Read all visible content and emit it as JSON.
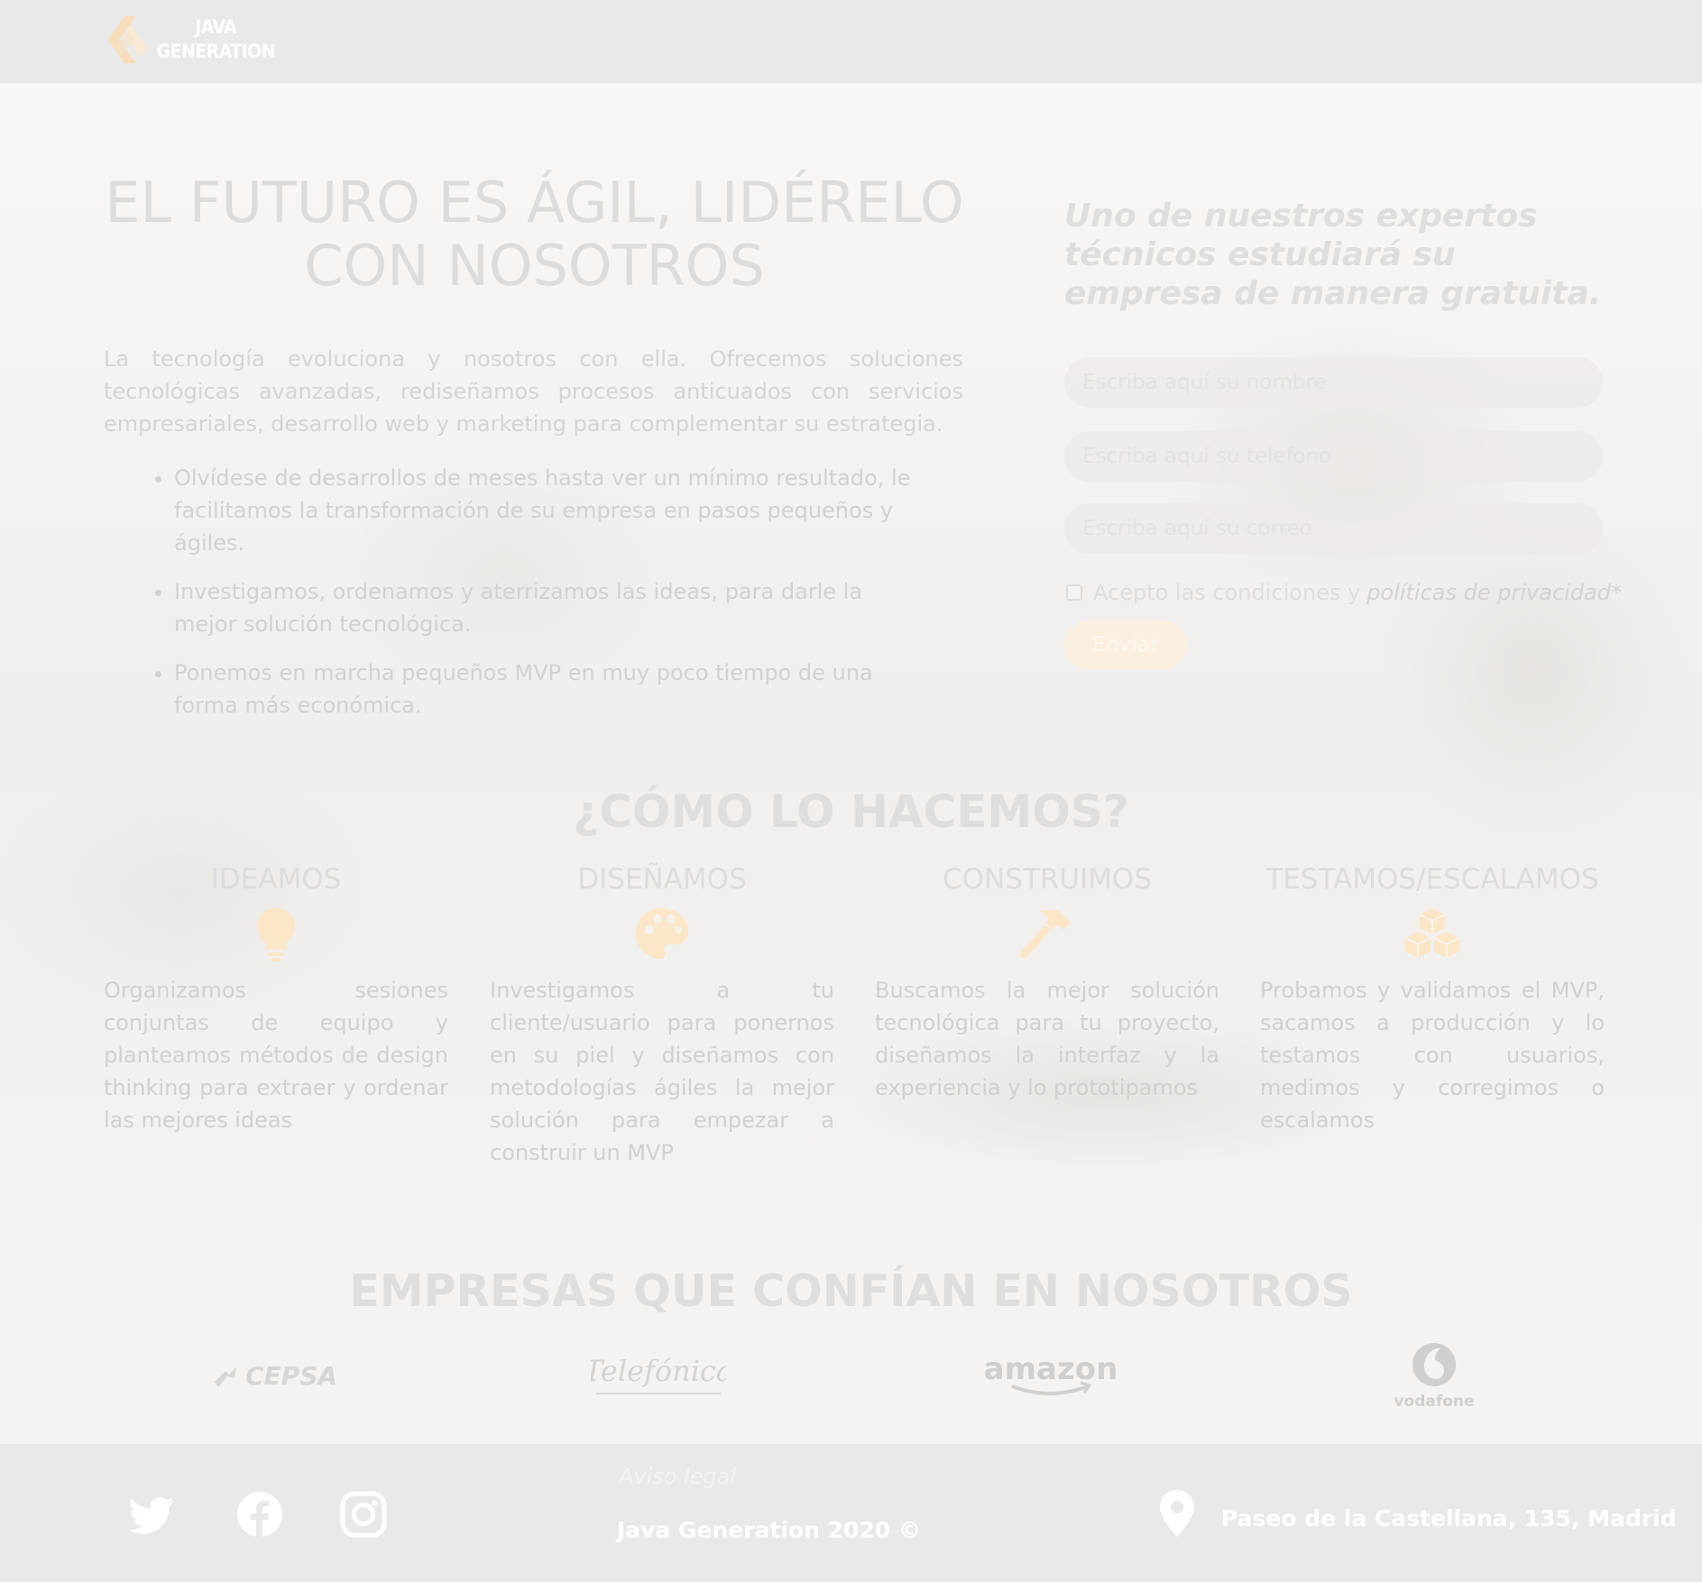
{
  "brand": {
    "logo_line1": "JAVA",
    "logo_line2": "GENERATION",
    "accent_color": "#fbe9cf"
  },
  "hero": {
    "title": "EL FUTURO ES ÁGIL, LIDÉRELO CON NOSOTROS",
    "intro": "La tecnología evoluciona y nosotros con ella. Ofrecemos soluciones tecnológicas avanzadas, rediseñamos procesos anticuados con servicios empresariales, desarrollo web y marketing para complementar su estrategia.",
    "bullets": [
      "Olvídese de desarrollos de meses hasta ver un mínimo resultado, le facilitamos la transformación de su empresa en pasos pequeños y ágiles.",
      "Investigamos, ordenamos y aterrizamos las ideas, para darle la mejor solución tecnológica.",
      "Ponemos en marcha pequeños MVP en muy poco tiempo de una forma más económica."
    ]
  },
  "form": {
    "heading": "Uno de nuestros expertos técnicos estudiará su empresa de manera gratuita.",
    "name_placeholder": "Escriba aquí su nombre",
    "phone_placeholder": "Escriba aquí su telefono",
    "email_placeholder": "Escriba aquí su correo",
    "consent_text": "Acepto las condiciones y",
    "consent_link": "políticas de privacidad*",
    "submit_label": "Enviar"
  },
  "how": {
    "title": "¿CÓMO LO HACEMOS?",
    "steps": [
      {
        "title": "IDEAMOS",
        "icon": "lightbulb-icon",
        "text": "Organizamos sesiones conjuntas de equipo y planteamos métodos de design thinking para extraer y ordenar las mejores ideas"
      },
      {
        "title": "DISEÑAMOS",
        "icon": "palette-icon",
        "text": "Investigamos a tu cliente/usuario para ponernos en su piel y diseñamos con metodologías ágiles la mejor solución para empezar a construir un MVP"
      },
      {
        "title": "CONSTRUIMOS",
        "icon": "hammer-icon",
        "text": "Buscamos la mejor solución tecnológica para tu proyecto, diseñamos la interfaz y la experiencia y lo prototipamos"
      },
      {
        "title": "TESTAMOS/ESCALAMOS",
        "icon": "cubes-icon",
        "text": "Probamos y validamos el MVP, sacamos a producción y lo testamos con usuarios, medimos y corregimos o escalamos"
      }
    ]
  },
  "clients": {
    "title": "EMPRESAS QUE CONFÍAN EN NOSOTROS",
    "logos": [
      "CEPSA",
      "Telefónica",
      "amazon",
      "vodafone"
    ]
  },
  "footer": {
    "legal_link": "Aviso legal",
    "copyright": "Java Generation 2020 ©",
    "address": "Paseo de la Castellana, 135, Madrid",
    "social": [
      "twitter-icon",
      "facebook-icon",
      "instagram-icon"
    ]
  }
}
